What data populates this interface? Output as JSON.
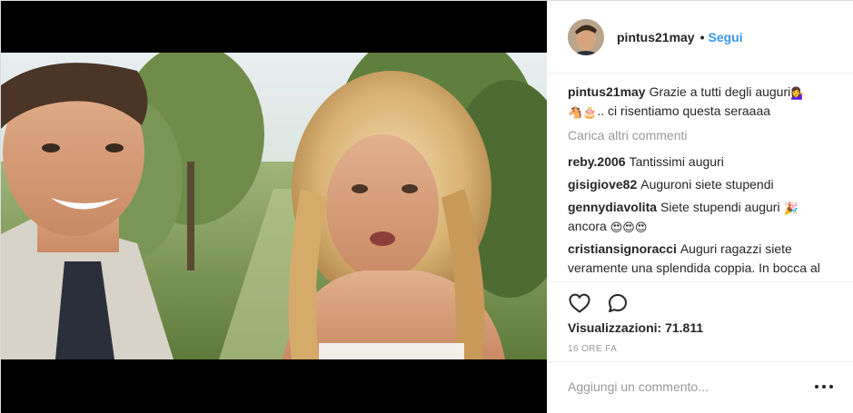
{
  "post": {
    "username": "pintus21may",
    "separator": "•",
    "follow_label": "Segui",
    "caption_user": "pintus21may",
    "caption_text": "Grazie a tutti degli auguri",
    "caption_text_2": ".. ci risentiamo questa seraaaa",
    "caption_emojis": [
      "woman-tipping-hand-emoji",
      "horse-emoji",
      "birthday-cake-emoji"
    ]
  },
  "load_more_label": "Carica altri commenti",
  "comments": [
    {
      "user": "reby.2006",
      "text": "Tantissimi auguri"
    },
    {
      "user": "gisigiove82",
      "text": "Auguroni siete stupendi"
    },
    {
      "user": "gennydiavolita",
      "text": "Siete stupendi auguri",
      "text_2": "ancora",
      "emojis": [
        "party-popper-emoji",
        "heart-eyes-emoji",
        "heart-eyes-emoji",
        "heart-eyes-emoji"
      ]
    },
    {
      "user": "cristiansignoracci",
      "text": "Auguri ragazzi siete veramente una splendida coppia. In bocca al lupo per la vostra vita. Un saluto anche al"
    }
  ],
  "stats": {
    "views": "Visualizzazioni: 71.811",
    "time": "16 ORE FA"
  },
  "add_comment": {
    "placeholder": "Aggiungi un commento..."
  },
  "icons": {
    "like": "heart-outline-icon",
    "comment": "speech-bubble-icon",
    "more": "more-options-icon"
  },
  "colors": {
    "link": "#3897f0",
    "muted": "#999999",
    "text": "#262626"
  }
}
